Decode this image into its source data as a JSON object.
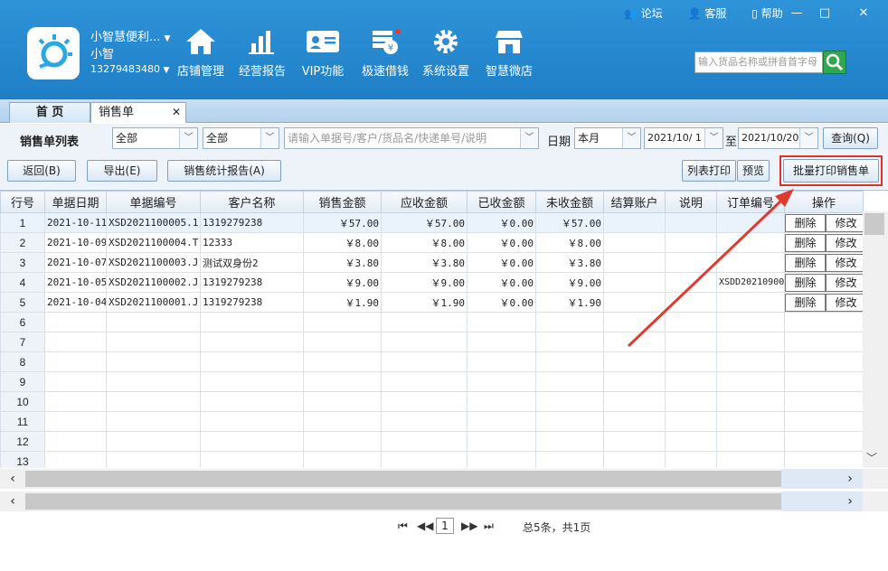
{
  "header": {
    "shop_name": "小智慧便利...",
    "user_name": "小智",
    "phone": "13279483480",
    "links": [
      "论坛",
      "客服",
      "帮助"
    ],
    "search_placeholder": "输入货品名称或拼音首字母"
  },
  "nav": [
    {
      "label": "店铺管理",
      "icon": "home-icon"
    },
    {
      "label": "经营报告",
      "icon": "bar-chart-icon"
    },
    {
      "label": "VIP功能",
      "icon": "vip-card-icon"
    },
    {
      "label": "极速借钱",
      "icon": "money-icon"
    },
    {
      "label": "系统设置",
      "icon": "gear-icon"
    },
    {
      "label": "智慧微店",
      "icon": "shop-icon"
    }
  ],
  "tabs": {
    "home": "首 页",
    "sales": "销售单"
  },
  "filter": {
    "title": "销售单列表",
    "select1": "全部",
    "select2": "全部",
    "search_placeholder": "请输入单据号/客户/货品名/快递单号/说明",
    "date_label": "日期",
    "period": "本月",
    "date_from": "2021/10/ 1",
    "to_label": "至",
    "date_to": "2021/10/20",
    "query_btn": "查询(Q)"
  },
  "actions": {
    "back": "返回(B)",
    "export": "导出(E)",
    "report": "销售统计报告(A)",
    "list_print": "列表打印",
    "preview": "预览",
    "batch_print": "批量打印销售单"
  },
  "table": {
    "columns": [
      "行号",
      "单据日期",
      "单据编号",
      "客户名称",
      "销售金额",
      "应收金额",
      "已收金额",
      "未收金额",
      "结算账户",
      "说明",
      "订单编号",
      "操作"
    ],
    "rows": [
      {
        "date": "2021-10-11",
        "no": "XSD2021100005.1",
        "customer": "1319279238",
        "sales": "￥57.00",
        "receivable": "￥57.00",
        "received": "￥0.00",
        "unreceived": "￥57.00",
        "account": "",
        "note": "",
        "order": ""
      },
      {
        "date": "2021-10-09",
        "no": "XSD2021100004.T",
        "customer": "12333",
        "sales": "￥8.00",
        "receivable": "￥8.00",
        "received": "￥0.00",
        "unreceived": "￥8.00",
        "account": "",
        "note": "",
        "order": ""
      },
      {
        "date": "2021-10-07",
        "no": "XSD2021100003.J",
        "customer": "测试双身份2",
        "sales": "￥3.80",
        "receivable": "￥3.80",
        "received": "￥0.00",
        "unreceived": "￥3.80",
        "account": "",
        "note": "",
        "order": ""
      },
      {
        "date": "2021-10-05",
        "no": "XSD2021100002.J",
        "customer": "1319279238",
        "sales": "￥9.00",
        "receivable": "￥9.00",
        "received": "￥0.00",
        "unreceived": "￥9.00",
        "account": "",
        "note": "",
        "order": "XSDD20210900"
      },
      {
        "date": "2021-10-04",
        "no": "XSD2021100001.J",
        "customer": "1319279238",
        "sales": "￥1.90",
        "receivable": "￥1.90",
        "received": "￥0.00",
        "unreceived": "￥1.90",
        "account": "",
        "note": "",
        "order": ""
      }
    ],
    "delete_label": "删除",
    "edit_label": "修改",
    "row_numbers": [
      "1",
      "2",
      "3",
      "4",
      "5",
      "6",
      "7",
      "8",
      "9",
      "10",
      "11",
      "12",
      "13"
    ]
  },
  "pager": {
    "page": "1",
    "summary": "总5条，共1页"
  },
  "colors": {
    "header": "#2a8cd4",
    "highlight": "#d9342b"
  }
}
